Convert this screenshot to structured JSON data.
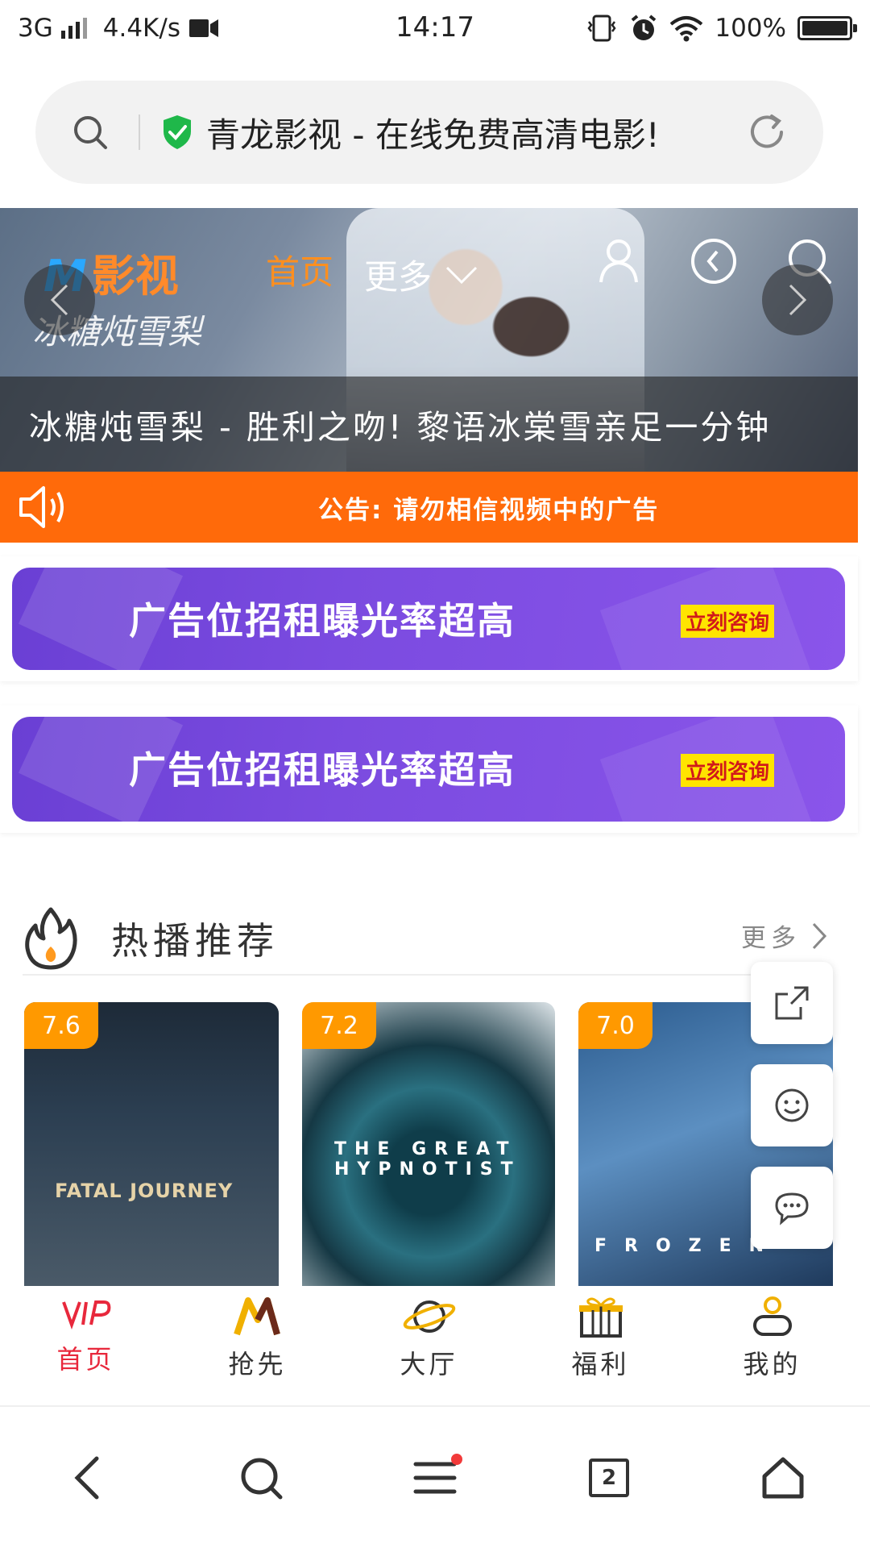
{
  "status_bar": {
    "network": "3G",
    "speed": "4.4K/s",
    "time": "14:17",
    "battery": "100%"
  },
  "url_bar": {
    "title": "青龙影视 - 在线免费高清电影!",
    "secure_color": "#1fb84a"
  },
  "hero": {
    "logo_mark": "M",
    "logo_text": "影视",
    "nav_home": "首页",
    "nav_more": "更多",
    "overlay_text": "冰糖炖雪梨",
    "caption": "冰糖炖雪梨 - 胜利之吻! 黎语冰棠雪亲足一分钟"
  },
  "notice": {
    "text": "公告: 请勿相信视频中的广告",
    "color": "#ff6a0a"
  },
  "ads": [
    {
      "text": "广告位招租曝光率超高",
      "cta": "立刻咨询"
    },
    {
      "text": "广告位招租曝光率超高",
      "cta": "立刻咨询"
    }
  ],
  "section": {
    "title": "热播推荐",
    "more": "更多"
  },
  "movies": [
    {
      "rating": "7.6",
      "poster_text": "FATAL JOURNEY"
    },
    {
      "rating": "7.2",
      "poster_text": "THE GREAT HYPNOTIST"
    },
    {
      "rating": "7.0",
      "poster_text": "FROZEN"
    }
  ],
  "tabs": [
    {
      "label": "首页",
      "icon": "vip-icon",
      "active": true
    },
    {
      "label": "抢先",
      "icon": "m-logo-icon",
      "active": false
    },
    {
      "label": "大厅",
      "icon": "planet-icon",
      "active": false
    },
    {
      "label": "福利",
      "icon": "gift-icon",
      "active": false
    },
    {
      "label": "我的",
      "icon": "user-icon",
      "active": false
    }
  ],
  "browser_bar": {
    "tab_count": "2"
  },
  "colors": {
    "accent_orange": "#ff9900",
    "active_red": "#e8283c",
    "ad_purple": "#7b4be0"
  }
}
